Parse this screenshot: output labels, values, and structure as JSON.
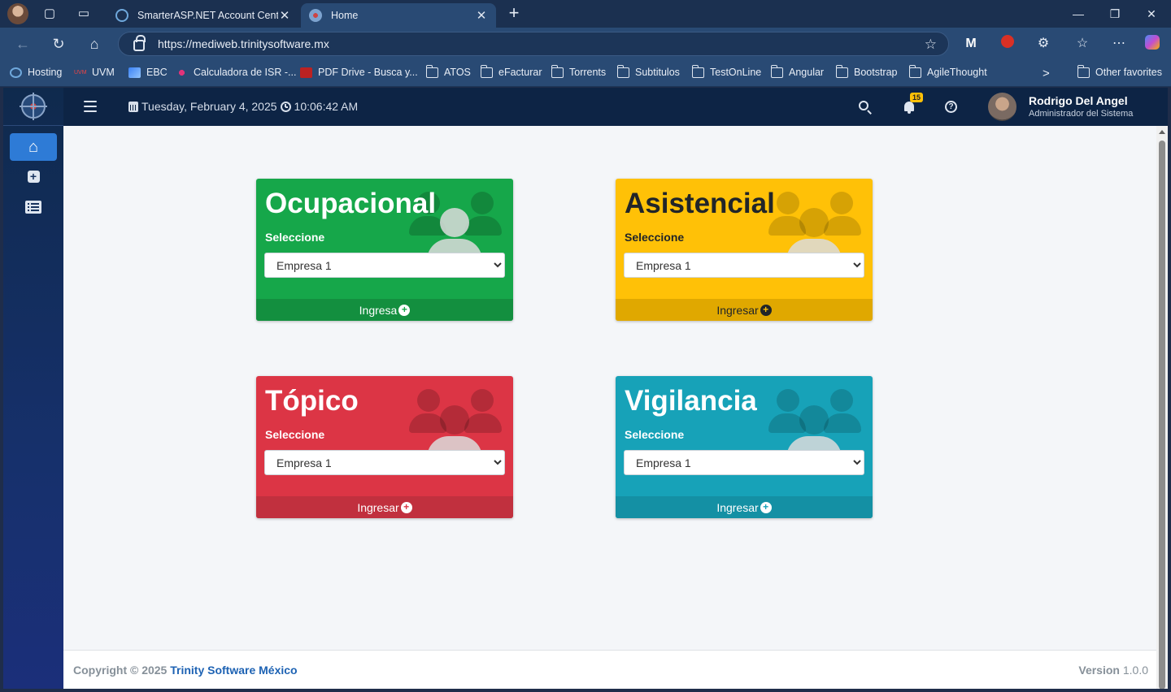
{
  "browser": {
    "tabs": [
      {
        "title": "SmarterASP.NET Account Center",
        "close": "✕"
      },
      {
        "title": "Home",
        "close": "✕"
      }
    ],
    "new_tab": "+",
    "url": "https://mediweb.trinitysoftware.mx",
    "bookmarks": [
      "Hosting",
      "UVM",
      "EBC",
      "Calculadora de ISR -...",
      "PDF Drive - Busca y...",
      "ATOS",
      "eFacturar",
      "Torrents",
      "Subtitulos",
      "TestOnLine",
      "Angular",
      "Bootstrap",
      "AgileThought"
    ],
    "other_favorites": "Other favorites",
    "bookmarks_overflow": ">"
  },
  "header": {
    "date": "Tuesday, February 4, 2025",
    "time": "10:06:42 AM",
    "notifications_count": "15",
    "user_name": "Rodrigo Del Angel",
    "user_role": "Administrador del Sistema"
  },
  "cards": [
    {
      "title": "Ocupacional",
      "label": "Seleccione",
      "selected": "Empresa 1",
      "action": "Ingresa",
      "color": "#16a74a"
    },
    {
      "title": "Asistencial",
      "label": "Seleccione",
      "selected": "Empresa 1",
      "action": "Ingresar",
      "color": "#ffc107"
    },
    {
      "title": "Tópico",
      "label": "Seleccione",
      "selected": "Empresa 1",
      "action": "Ingresar",
      "color": "#dc3545"
    },
    {
      "title": "Vigilancia",
      "label": "Seleccione",
      "selected": "Empresa 1",
      "action": "Ingresar",
      "color": "#17a2b8"
    }
  ],
  "footer": {
    "copyright_prefix": "Copyright © 2025",
    "brand": "Trinity Software México",
    "version_label": "Version",
    "version_value": "1.0.0"
  }
}
